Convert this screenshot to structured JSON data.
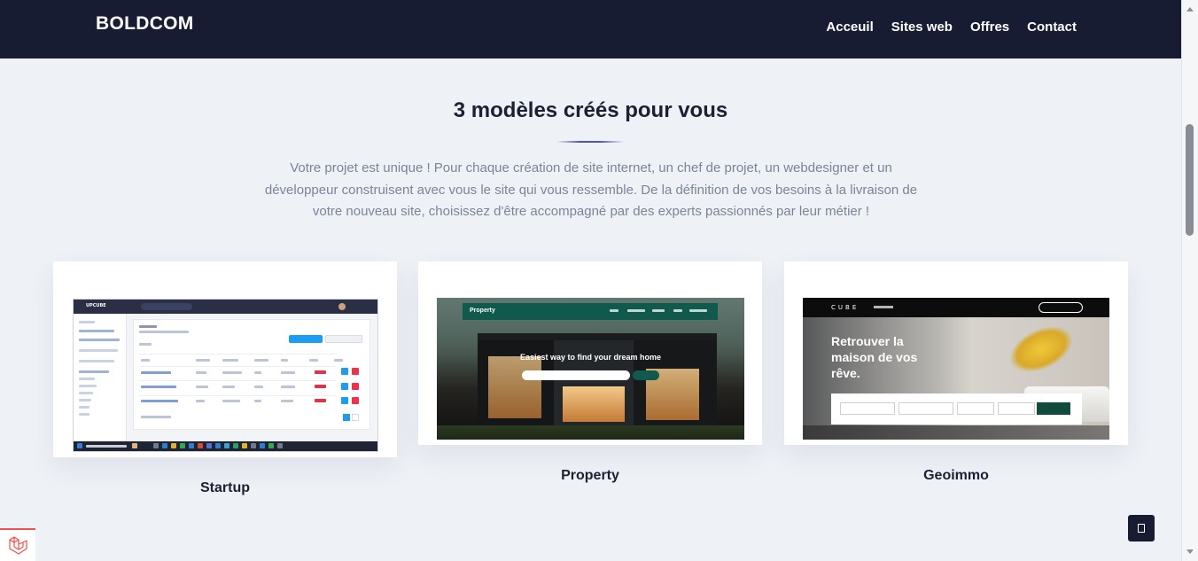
{
  "header": {
    "brand": "BOLDCOM",
    "nav": [
      "Acceuil",
      "Sites web",
      "Offres",
      "Contact"
    ]
  },
  "section": {
    "title": "3 modèles créés pour vous",
    "intro": "Votre projet est unique ! Pour chaque création de site internet, un chef de projet, un webdesigner et un développeur construisent avec vous le site qui vous ressemble. De la définition de vos besoins à la livraison de votre nouveau site, choisissez d'être accompagné par des experts passionnés par leur métier !"
  },
  "templates": [
    {
      "name": "Startup",
      "preview": {
        "logo": "UPCUBE"
      }
    },
    {
      "name": "Property",
      "preview": {
        "brand": "Property",
        "headline": "Easiest way to find your dream home"
      }
    },
    {
      "name": "Geoimmo",
      "preview": {
        "brand": "CUBE",
        "headline": "Retrouver la maison de vos rêve."
      }
    }
  ],
  "widgets": {
    "back_to_top_icon": "square-icon",
    "framework_badge_icon": "laravel-icon"
  },
  "colors": {
    "header_bg": "#181c32",
    "page_bg": "#eef1f6",
    "accent_rule": "#4a56be",
    "intro_text": "#7c8498"
  }
}
